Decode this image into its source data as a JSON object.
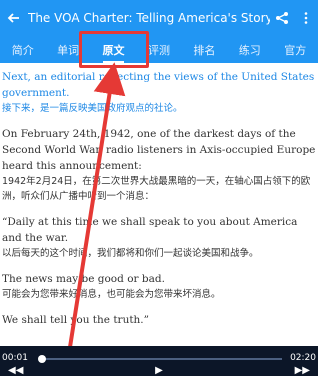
{
  "appbar": {
    "back_icon": "arrow-left",
    "title": "The VOA Charter: Telling America's Story",
    "share_icon": "share",
    "more_icon": "more-vertical"
  },
  "tabs": [
    {
      "label": "简介"
    },
    {
      "label": "单词"
    },
    {
      "label": "原文"
    },
    {
      "label": "评测"
    },
    {
      "label": "排名"
    },
    {
      "label": "练习"
    },
    {
      "label": "官方"
    }
  ],
  "active_tab_index": 2,
  "content": {
    "paragraphs": [
      {
        "en": "Next, an editorial reflecting the views of the United States government.",
        "zh": "接下来，是一篇反映美国政府观点的社论。"
      },
      {
        "en": "On February 24th, 1942, one of the darkest days of the Second World War, radio listeners in Axis-occupied Europe heard this announcement:",
        "zh": "1942年2月24日，在第二次世界大战最黑暗的一天，在轴心国占领下的欧洲，听众们从广播中听到一个消息："
      },
      {
        "en": "“Daily at this time we shall speak to you about America and the war.",
        "zh": "以后每天的这个时间，我们都将和你们一起谈论美国和战争。"
      },
      {
        "en": "The news may be good or bad.",
        "zh": "可能会为您带来好消息，也可能会为您带来坏消息。"
      },
      {
        "en": "We shall tell you the truth.”",
        "zh": ""
      }
    ]
  },
  "player": {
    "current_time": "00:01",
    "total_time": "02:20",
    "progress_fraction": 0.01
  },
  "colors": {
    "primary": "#2196f3",
    "highlight_red": "#e53935",
    "player_bg": "#0c1628"
  }
}
